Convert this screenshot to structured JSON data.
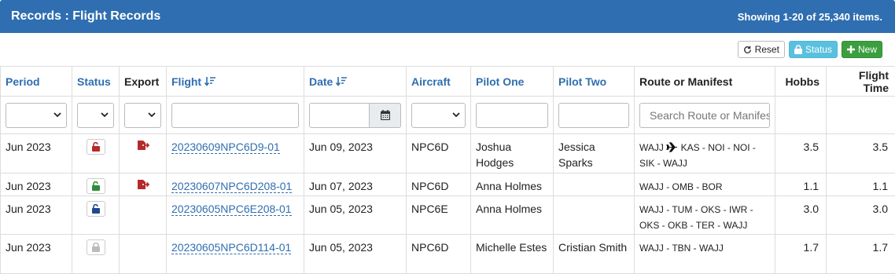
{
  "header": {
    "title": "Records : Flight Records",
    "count": "Showing 1-20 of 25,340 items."
  },
  "toolbar": {
    "reset_label": "Reset",
    "status_label": "Status",
    "new_label": "New"
  },
  "columns": {
    "period": "Period",
    "status": "Status",
    "export": "Export",
    "flight": "Flight",
    "date": "Date",
    "aircraft": "Aircraft",
    "pilot_one": "Pilot One",
    "pilot_two": "Pilot Two",
    "route": "Route or Manifest",
    "hobbs": "Hobbs",
    "flight_time": "Flight Time"
  },
  "filters": {
    "route_placeholder": "Search Route or Manifest"
  },
  "rows": [
    {
      "period": "Jun 2023",
      "lock": "unlocked-red",
      "export": true,
      "flight": "20230609NPC6D9-01",
      "date": "Jun 09, 2023",
      "aircraft": "NPC6D",
      "pilot_one": "Joshua Hodges",
      "pilot_two": "Jessica Sparks",
      "route_a": "WAJJ",
      "route_b": "KAS - NOI - NOI - SIK - WAJJ",
      "hobbs": "3.5",
      "flight_time": "3.5"
    },
    {
      "period": "Jun 2023",
      "lock": "unlocked-green",
      "export": true,
      "flight": "20230607NPC6D208-01",
      "date": "Jun 07, 2023",
      "aircraft": "NPC6D",
      "pilot_one": "Anna Holmes",
      "pilot_two": "",
      "route": "WAJJ - OMB - BOR",
      "hobbs": "1.1",
      "flight_time": "1.1"
    },
    {
      "period": "Jun 2023",
      "lock": "unlocked-blue",
      "export": false,
      "flight": "20230605NPC6E208-01",
      "date": "Jun 05, 2023",
      "aircraft": "NPC6E",
      "pilot_one": "Anna Holmes",
      "pilot_two": "",
      "route": "WAJJ - TUM - OKS - IWR - OKS - OKB - TER - WAJJ",
      "hobbs": "3.0",
      "flight_time": "3.0"
    },
    {
      "period": "Jun 2023",
      "lock": "locked-gray",
      "export": false,
      "flight": "20230605NPC6D114-01",
      "date": "Jun 05, 2023",
      "aircraft": "NPC6D",
      "pilot_one": "Michelle Estes",
      "pilot_two": "Cristian Smith",
      "route": "WAJJ - TBN - WAJJ",
      "hobbs": "1.7",
      "flight_time": "1.7"
    }
  ],
  "colors": {
    "header_bg": "#2f6eb0",
    "link": "#2f6eb0",
    "lock_red": "#b52a2a",
    "lock_green": "#2e8b3a",
    "lock_blue": "#1e4a8a",
    "lock_gray": "#bbbbbb"
  }
}
